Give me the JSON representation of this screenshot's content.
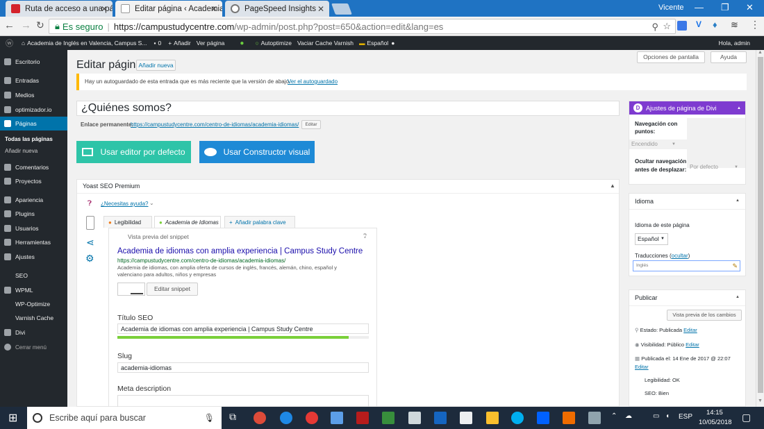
{
  "browser": {
    "tabs": [
      {
        "title": "Ruta de acceso a una pág",
        "favicon_color": "#d4232b"
      },
      {
        "title": "Editar página ‹ Academia",
        "favicon_color": "#555"
      },
      {
        "title": "PageSpeed Insights",
        "favicon_color": "#777"
      }
    ],
    "user": "Vicente",
    "secure_label": "Es seguro",
    "url_main": "https://campustudycentre.com",
    "url_rest": "/wp-admin/post.php?post=650&action=edit&lang=es"
  },
  "adminbar": {
    "site": "Academia de Inglés en Valencia, Campus S...",
    "comments": "0",
    "add": "Añadir",
    "view": "Ver página",
    "autoptimize": "Autoptimize",
    "varnish": "Vaciar Cache Varnish",
    "lang": "Español",
    "greeting": "Hola, admin"
  },
  "sidebar": {
    "items": [
      {
        "label": "Escritorio"
      },
      {
        "label": "Entradas"
      },
      {
        "label": "Medios"
      },
      {
        "label": "optimizador.io"
      },
      {
        "label": "Páginas"
      },
      {
        "label": "Comentarios"
      },
      {
        "label": "Proyectos"
      },
      {
        "label": "Apariencia"
      },
      {
        "label": "Plugins"
      },
      {
        "label": "Usuarios"
      },
      {
        "label": "Herramientas"
      },
      {
        "label": "Ajustes"
      },
      {
        "label": "SEO"
      },
      {
        "label": "WPML"
      },
      {
        "label": "WP-Optimize"
      },
      {
        "label": "Varnish Cache"
      },
      {
        "label": "Divi"
      },
      {
        "label": "Cerrar menú"
      }
    ],
    "subitems": [
      "Todas las páginas",
      "Añadir nueva"
    ]
  },
  "main": {
    "screen_options": "Opciones de pantalla",
    "help": "Ayuda",
    "heading": "Editar página",
    "add_new": "Añadir nueva",
    "notice": "Hay un autoguardado de esta entrada que es más reciente que la versión de abajo.",
    "notice_link": "Ver el autoguardado",
    "title_value": "¿Quiénes somos?",
    "permalink_label": "Enlace permanente:",
    "permalink_url": "https://campustudycentre.com/centro-de-idiomas/academia-idiomas/",
    "permalink_edit": "Editar",
    "default_editor": "Usar editor por defecto",
    "visual_builder": "Usar Constructor visual"
  },
  "yoast": {
    "title": "Yoast SEO Premium",
    "help": "¿Necesitas ayuda?",
    "tabs": [
      "Legibilidad",
      "Academia de Idiomas",
      "Añadir palabra clave"
    ],
    "snippet_label": "Vista previa del snippet",
    "snippet_title": "Academia de idiomas con amplia experiencia | Campus Study Centre",
    "snippet_url": "https://campustudycentre.com/centro-de-idiomas/academia-idiomas/",
    "snippet_desc": "Academia de idiomas, con amplia oferta de cursos de inglés, francés, alemán, chino, español y valenciano para adultos, niños y empresas",
    "edit_snippet": "Editar snippet",
    "seo_title_label": "Título SEO",
    "seo_title_value": "Academia de idiomas con amplia experiencia | Campus Study Centre",
    "seo_title_progress": 0.92,
    "slug_label": "Slug",
    "slug_value": "academia-idiomas",
    "meta_label": "Meta description"
  },
  "divi_box": {
    "title": "Ajustes de página de Divi",
    "dot_nav_label": "Navegación con puntos:",
    "dot_nav_value": "Encendido",
    "hide_nav_label": "Ocultar navegación antes de desplazar:",
    "hide_nav_value": "Por defecto"
  },
  "lang_box": {
    "title": "Idioma",
    "page_lang_label": "Idioma de este página",
    "page_lang_value": "Español",
    "translations_label": "Traducciones (",
    "translations_hide": "ocultar",
    "translations_close": ")",
    "translation_lang": "Inglés"
  },
  "publish_box": {
    "title": "Publicar",
    "preview_btn": "Vista previa de los cambios",
    "status_label": "Estado:",
    "status_value": "Publicada",
    "visibility_label": "Visibilidad:",
    "visibility_value": "Público",
    "published_label": "Publicada el:",
    "published_value": "14 Ene de 2017 @ 22:07",
    "edit": "Editar",
    "readability": "Legibilidad: OK",
    "seo": "SEO: Bien"
  },
  "taskbar": {
    "search_placeholder": "Escribe aquí para buscar",
    "lang": "ESP",
    "time": "14:15",
    "date": "10/05/2018"
  },
  "colors": {
    "wp_blue": "#0073aa",
    "divi_purple": "#7e3bd0",
    "teal": "#2ec4a8",
    "builder_blue": "#1e8ad6",
    "green_progress": "#7ad03a"
  }
}
